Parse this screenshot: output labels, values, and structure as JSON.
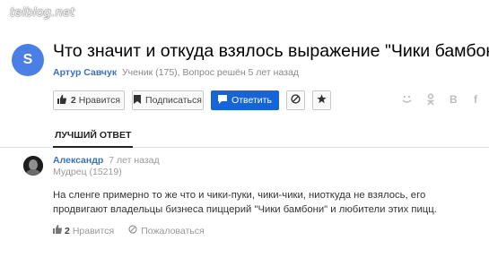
{
  "watermark": "telblog.net",
  "question": {
    "avatar_letter": "S",
    "avatar_color": "#4a80e5",
    "title": "Что значит и откуда взялось выражение \"Чики бамбони\"",
    "author": "Артур Савчук",
    "meta": "Ученик (175), Вопрос решён 5 лет назад"
  },
  "actions": {
    "like_count": "2",
    "like_label": "Нравится",
    "subscribe_label": "Подписаться",
    "answer_label": "Ответить",
    "accent_color": "#1565d8"
  },
  "share_icons": [
    "smile-icon",
    "odnoklassniki-icon",
    "vk-icon",
    "facebook-icon"
  ],
  "share": {
    "vk": "В",
    "fb": "f"
  },
  "tab": {
    "label": "ЛУЧШИЙ ОТВЕТ"
  },
  "answer": {
    "author": "Александр",
    "ago": "7 лет назад",
    "rank": "Мудрец (15219)",
    "text": "На сленге примерно то же что и чики-пуки, чики-чики, ниоткуда не взялось, его продвигают владельцы бизнеса пиццерий \"Чики бамбони\" и любители этих пицц.",
    "like_count": "2",
    "like_label": "Нравится",
    "report_label": "Пожаловаться"
  }
}
